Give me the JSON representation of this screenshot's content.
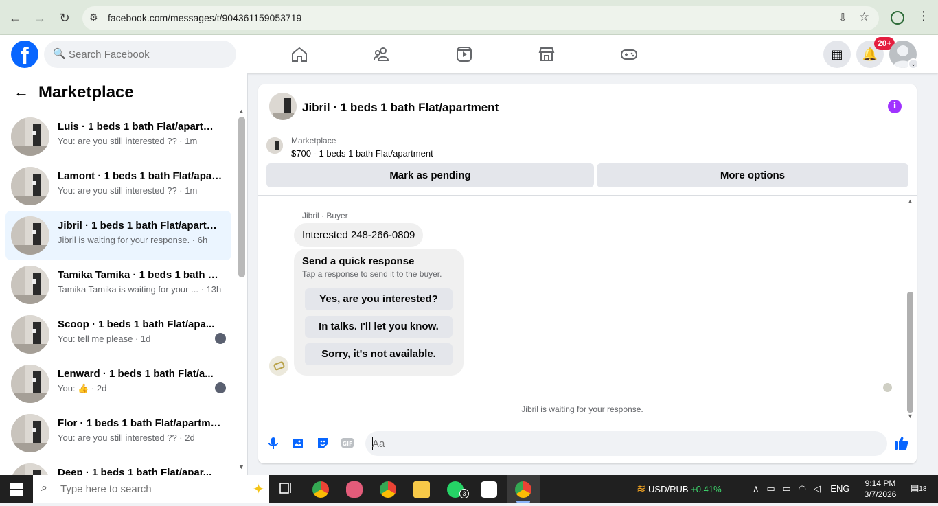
{
  "browser": {
    "url": "facebook.com/messages/t/904361159053719"
  },
  "fb": {
    "search_placeholder": "Search Facebook",
    "notif_count": "20+"
  },
  "sidebar": {
    "title": "Marketplace",
    "conversations": [
      {
        "name": "Luis · 1 beds 1 bath Flat/apartment",
        "snippet": "You: are you still interested ?? · 1m",
        "active": false,
        "seen": false
      },
      {
        "name": "Lamont · 1 beds 1 bath Flat/apar...",
        "snippet": "You: are you still interested ?? · 1m",
        "active": false,
        "seen": false
      },
      {
        "name": "Jibril · 1 beds 1 bath Flat/apartm...",
        "snippet": "Jibril is waiting for your response. · 6h",
        "active": true,
        "seen": false
      },
      {
        "name": "Tamika Tamika · 1 beds 1 bath Fl...",
        "snippet": "Tamika Tamika is waiting for your ... · 13h",
        "active": false,
        "seen": false
      },
      {
        "name": "Scoop · 1 beds 1 bath Flat/apa...",
        "snippet": "You: tell me please · 1d",
        "active": false,
        "seen": true
      },
      {
        "name": "Lenward · 1 beds 1 bath Flat/a...",
        "snippet": "You: 👍 · 2d",
        "active": false,
        "seen": true
      },
      {
        "name": "Flor · 1 beds 1 bath Flat/apartment",
        "snippet": "You: are you still interested ?? · 2d",
        "active": false,
        "seen": false
      },
      {
        "name": "Deep · 1 beds 1 bath Flat/apar...",
        "snippet": "",
        "active": false,
        "seen": true
      }
    ]
  },
  "chat": {
    "title": "Jibril · 1 beds 1 bath Flat/apartment",
    "listing_category": "Marketplace",
    "listing_title": "$700 - 1 beds 1 bath Flat/apartment",
    "mark_pending": "Mark as pending",
    "more_options": "More options",
    "sender_label": "Jibril · Buyer",
    "message": "Interested 248-266-0809",
    "quick_title": "Send a quick response",
    "quick_subtitle": "Tap a response to send it to the buyer.",
    "quick_replies": [
      "Yes, are you interested?",
      "In talks. I'll let you know.",
      "Sorry, it's not available."
    ],
    "waiting": "Jibril is waiting for your response.",
    "composer_placeholder": "Aa"
  },
  "taskbar": {
    "search_placeholder": "Type here to search",
    "ticker_label": "USD/RUB",
    "ticker_change": "+0.41%",
    "language": "ENG",
    "time": "9:14 PM",
    "date": "3/7/2026",
    "notif_count": "18",
    "whatsapp_count": "3"
  },
  "colors": {
    "fb_blue": "#0866ff",
    "active_row": "#ebf5ff",
    "info_purple": "#a033ff",
    "notif_red": "#e41e3f"
  }
}
